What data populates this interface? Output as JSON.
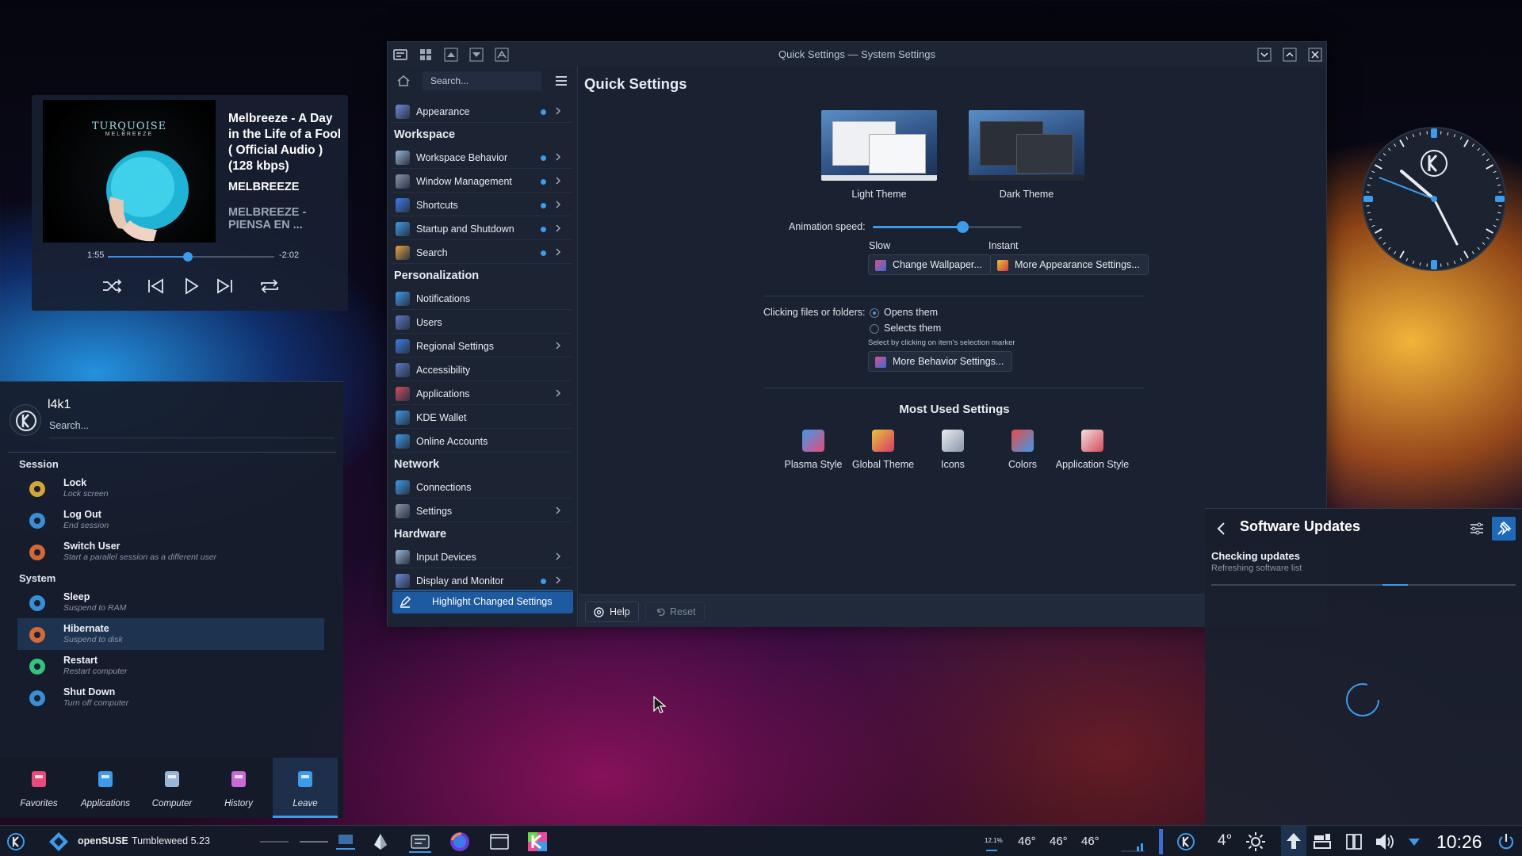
{
  "media": {
    "title": "Melbreeze - A Day in the Life of a Fool ( Official Audio ) (128 kbps)",
    "artist": "MELBREEZE",
    "album": "MELBREEZE - PIENSA EN ...",
    "elapsed": "1:55",
    "remaining": "-2:02",
    "progress": 0.48,
    "art_logo_top": "TURQUOISE",
    "art_logo_bottom": "MELBREEZE"
  },
  "launcher": {
    "username": "l4k1",
    "search_placeholder": "Search...",
    "sections": {
      "session": "Session",
      "system": "System"
    },
    "session_items": [
      {
        "title": "Lock",
        "subtitle": "Lock screen",
        "icon": "lock-icon"
      },
      {
        "title": "Log Out",
        "subtitle": "End session",
        "icon": "logout-icon"
      },
      {
        "title": "Switch User",
        "subtitle": "Start a parallel session as a different user",
        "icon": "switch-user-icon"
      }
    ],
    "system_items": [
      {
        "title": "Sleep",
        "subtitle": "Suspend to RAM",
        "icon": "sleep-icon"
      },
      {
        "title": "Hibernate",
        "subtitle": "Suspend to disk",
        "icon": "hibernate-icon"
      },
      {
        "title": "Restart",
        "subtitle": "Restart computer",
        "icon": "restart-icon"
      },
      {
        "title": "Shut Down",
        "subtitle": "Turn off computer",
        "icon": "power-icon"
      }
    ],
    "tabs": [
      "Favorites",
      "Applications",
      "Computer",
      "History",
      "Leave"
    ],
    "active_tab": "Leave"
  },
  "window": {
    "title": "Quick Settings — System Settings",
    "search_placeholder": "Search...",
    "page_title": "Quick Settings",
    "sidebar": {
      "top_item": "Appearance",
      "categories": {
        "workspace": "Workspace",
        "personalization": "Personalization",
        "network": "Network",
        "hardware": "Hardware"
      },
      "workspace_items": [
        "Workspace Behavior",
        "Window Management",
        "Shortcuts",
        "Startup and Shutdown",
        "Search"
      ],
      "personalization_items": [
        "Notifications",
        "Users",
        "Regional Settings",
        "Accessibility",
        "Applications",
        "KDE Wallet",
        "Online Accounts"
      ],
      "network_items": [
        "Connections",
        "Settings"
      ],
      "hardware_items": [
        "Input Devices",
        "Display and Monitor"
      ],
      "highlight_button": "Highlight Changed Settings"
    },
    "themes": {
      "light": "Light Theme",
      "dark": "Dark Theme"
    },
    "animation": {
      "label": "Animation speed:",
      "slow": "Slow",
      "instant": "Instant",
      "value": 0.6
    },
    "buttons": {
      "change_wallpaper": "Change Wallpaper...",
      "more_appearance": "More Appearance Settings...",
      "more_behavior": "More Behavior Settings...",
      "help": "Help",
      "reset": "Reset"
    },
    "clicking": {
      "label": "Clicking files or folders:",
      "opens": "Opens them",
      "selects": "Selects them",
      "hint": "Select by clicking on item's selection marker",
      "selected": "opens"
    },
    "most_used": {
      "title": "Most Used Settings",
      "items": [
        "Plasma Style",
        "Global Theme",
        "Icons",
        "Colors",
        "Application Style"
      ]
    }
  },
  "updates": {
    "title": "Software Updates",
    "status": "Checking updates",
    "detail": "Refreshing software list"
  },
  "taskbar": {
    "distro": "openSUSE",
    "version": "Tumbleweed 5.23",
    "cpu": "12.1%",
    "temps": [
      "46°",
      "46°",
      "46°"
    ],
    "weather": "4°",
    "time": "10:26"
  },
  "colors": {
    "accent": "#3d9be9",
    "panel": "#1c2434",
    "highlight": "#1e5aa0"
  }
}
